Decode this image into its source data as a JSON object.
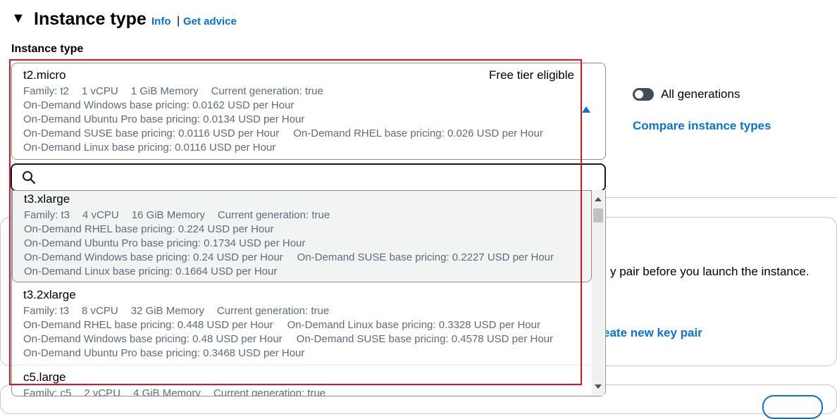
{
  "header": {
    "title": "Instance type",
    "info_link": "Info",
    "separator": "|",
    "advice_link": "Get advice"
  },
  "field": {
    "label": "Instance type"
  },
  "selected": {
    "name": "t2.micro",
    "badge": "Free tier eligible",
    "specs": [
      "Family: t2",
      "1 vCPU",
      "1 GiB Memory",
      "Current generation: true"
    ],
    "lines": [
      [
        "On-Demand Windows base pricing: 0.0162 USD per Hour"
      ],
      [
        "On-Demand Ubuntu Pro base pricing: 0.0134 USD per Hour"
      ],
      [
        "On-Demand SUSE base pricing: 0.0116 USD per Hour",
        "On-Demand RHEL base pricing: 0.026 USD per Hour"
      ],
      [
        "On-Demand Linux base pricing: 0.0116 USD per Hour"
      ]
    ]
  },
  "search": {
    "placeholder": ""
  },
  "options": [
    {
      "name": "t3.xlarge",
      "specs": [
        "Family: t3",
        "4 vCPU",
        "16 GiB Memory",
        "Current generation: true"
      ],
      "lines": [
        [
          "On-Demand RHEL base pricing: 0.224 USD per Hour"
        ],
        [
          "On-Demand Ubuntu Pro base pricing: 0.1734 USD per Hour"
        ],
        [
          "On-Demand Windows base pricing: 0.24 USD per Hour",
          "On-Demand SUSE base pricing: 0.2227 USD per Hour"
        ],
        [
          "On-Demand Linux base pricing: 0.1664 USD per Hour"
        ]
      ]
    },
    {
      "name": "t3.2xlarge",
      "specs": [
        "Family: t3",
        "8 vCPU",
        "32 GiB Memory",
        "Current generation: true"
      ],
      "lines": [
        [
          "On-Demand RHEL base pricing: 0.448 USD per Hour",
          "On-Demand Linux base pricing: 0.3328 USD per Hour"
        ],
        [
          "On-Demand Windows base pricing: 0.48 USD per Hour",
          "On-Demand SUSE base pricing: 0.4578 USD per Hour"
        ],
        [
          "On-Demand Ubuntu Pro base pricing: 0.3468 USD per Hour"
        ]
      ]
    },
    {
      "name": "c5.large",
      "specs": [
        "Family: c5",
        "2 vCPU",
        "4 GiB Memory",
        "Current generation: true"
      ]
    }
  ],
  "side": {
    "toggle_label": "All generations",
    "toggle_on": false,
    "compare_link": "Compare instance types",
    "keypair_text": "y pair before you launch the instance.",
    "create_keypair_link": "eate new key pair"
  },
  "colors": {
    "link": "#0972d3",
    "highlight": "#e8101d",
    "muted_text": "#5f6b7a"
  }
}
